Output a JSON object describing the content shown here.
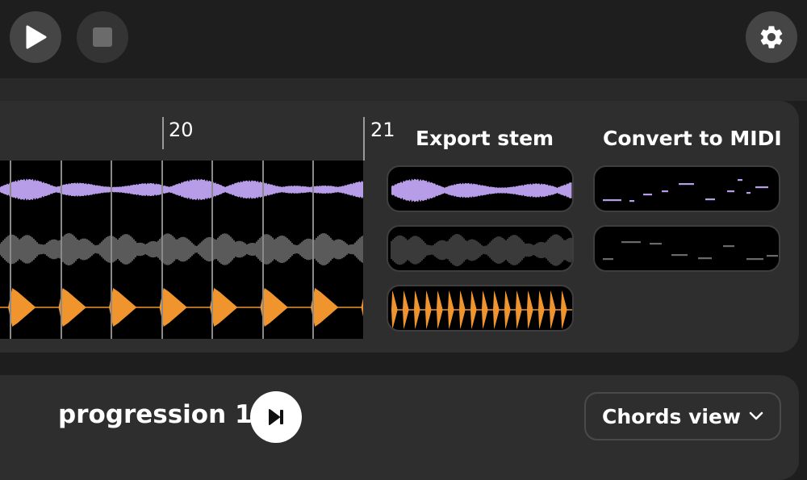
{
  "transport": {
    "play_icon": "play-icon",
    "stop_icon": "stop-icon",
    "settings_icon": "gear-icon"
  },
  "timeline": {
    "markers": [
      "20",
      "21"
    ]
  },
  "stems": {
    "export_title": "Export stem",
    "midi_title": "Convert to MIDI",
    "tracks": [
      {
        "id": "vocals",
        "color": "#b79ce8"
      },
      {
        "id": "other",
        "color": "#8a8a8a"
      },
      {
        "id": "drums",
        "color": "#f0952e"
      }
    ],
    "midi_colors": [
      "#b79ce8",
      "#8a8a8a"
    ]
  },
  "progression": {
    "title": "progression 1",
    "skip_icon": "skip-forward-icon",
    "view_select": "Chords view"
  },
  "colors": {
    "background": "#1e1e1e",
    "panel": "#2e2e2e",
    "waveform_bg": "#000000"
  }
}
